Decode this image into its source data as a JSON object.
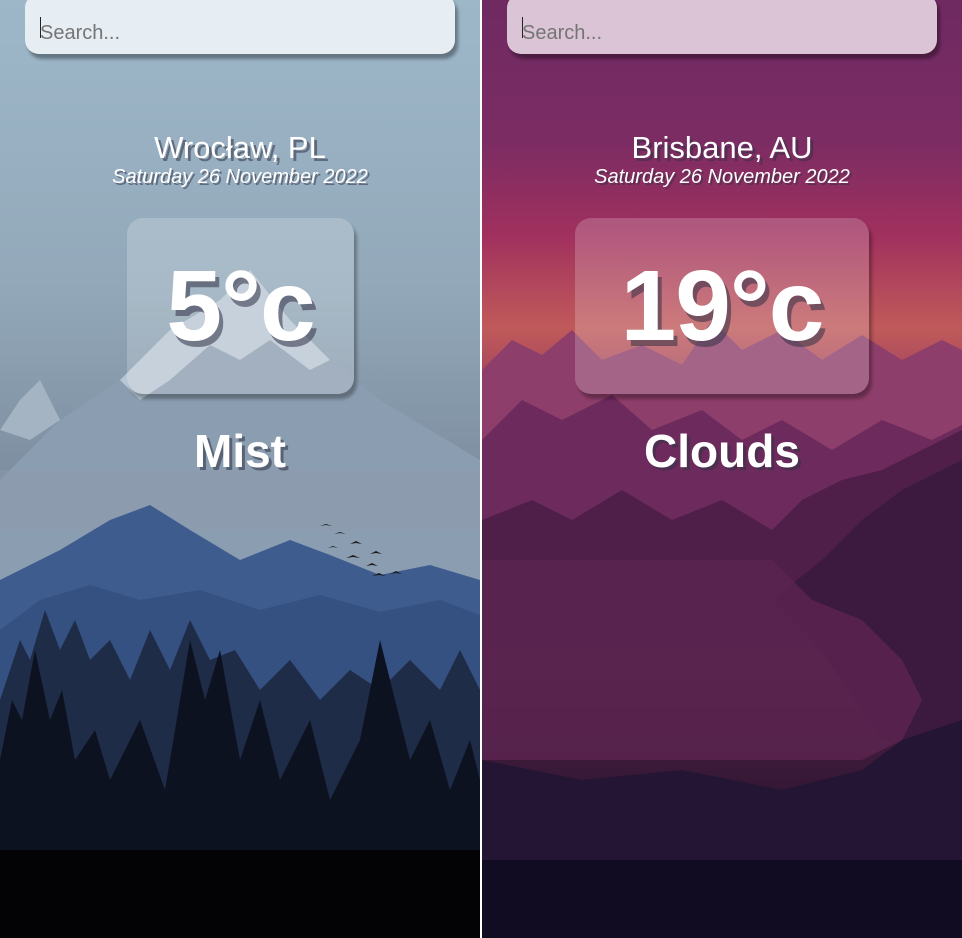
{
  "panels": [
    {
      "search": {
        "placeholder": "Search..."
      },
      "location": "Wrocław, PL",
      "date": "Saturday 26 November 2022",
      "temperature": "5°c",
      "condition": "Mist",
      "background": "mountains-forest-blue"
    },
    {
      "search": {
        "placeholder": "Search..."
      },
      "location": "Brisbane, AU",
      "date": "Saturday 26 November 2022",
      "temperature": "19°c",
      "condition": "Clouds",
      "background": "mountains-lake-purple"
    }
  ],
  "colors": {
    "left_sky": "#9fb6c7",
    "right_sky": "#7a2d63",
    "text": "#ffffff"
  }
}
